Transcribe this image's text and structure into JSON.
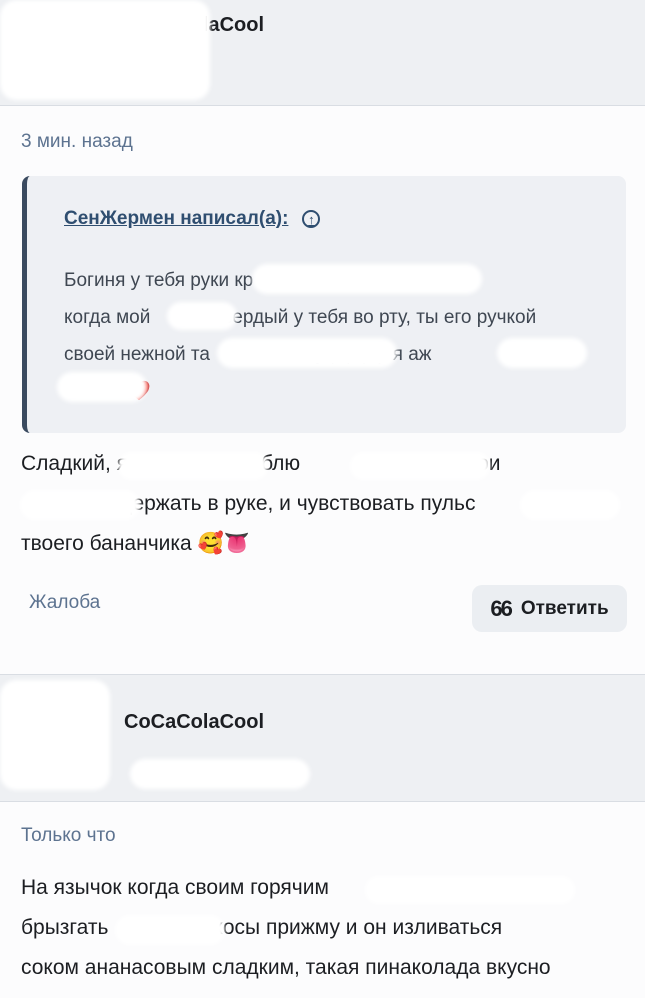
{
  "post1": {
    "author": "CoCaColaCool",
    "time": "3 мин. назад",
    "quote": {
      "author": "СенЖермен написал(а):",
      "text": "Богиня у тебя руки кр... чтобы когда мой ... твердый у тебя во рту, ты его ручкой своей нежной та... уфффф я аж..."
    },
    "quote_lines": [
      "Богиня у тебя руки кр                          чтобы",
      "когда мой            твердый у тебя во рту, ты его ручкой",
      "своей нежной та                    уфффф я аж",
      "            ❤️"
    ],
    "body_lines": [
      "Сладкий, я                  люблю                     у и твои",
      "                 держать в руке, и чувствовать пульс",
      "твоего бананчика 🥰👅"
    ],
    "report_label": "Жалоба",
    "reply_label": "Ответить"
  },
  "post2": {
    "author": "CoCaColaCool",
    "time": "Только что",
    "body_lines": [
      "На язычок когда своим горячим",
      "брызгать                  косы прижму и он изливаться",
      "соком ананасовым сладким, такая пинаколада вкусно"
    ]
  },
  "colors": {
    "header_bg": "#eef0f3",
    "quote_bg": "#eef0f4",
    "link": "#2f4e70",
    "muted": "#5d7390"
  }
}
